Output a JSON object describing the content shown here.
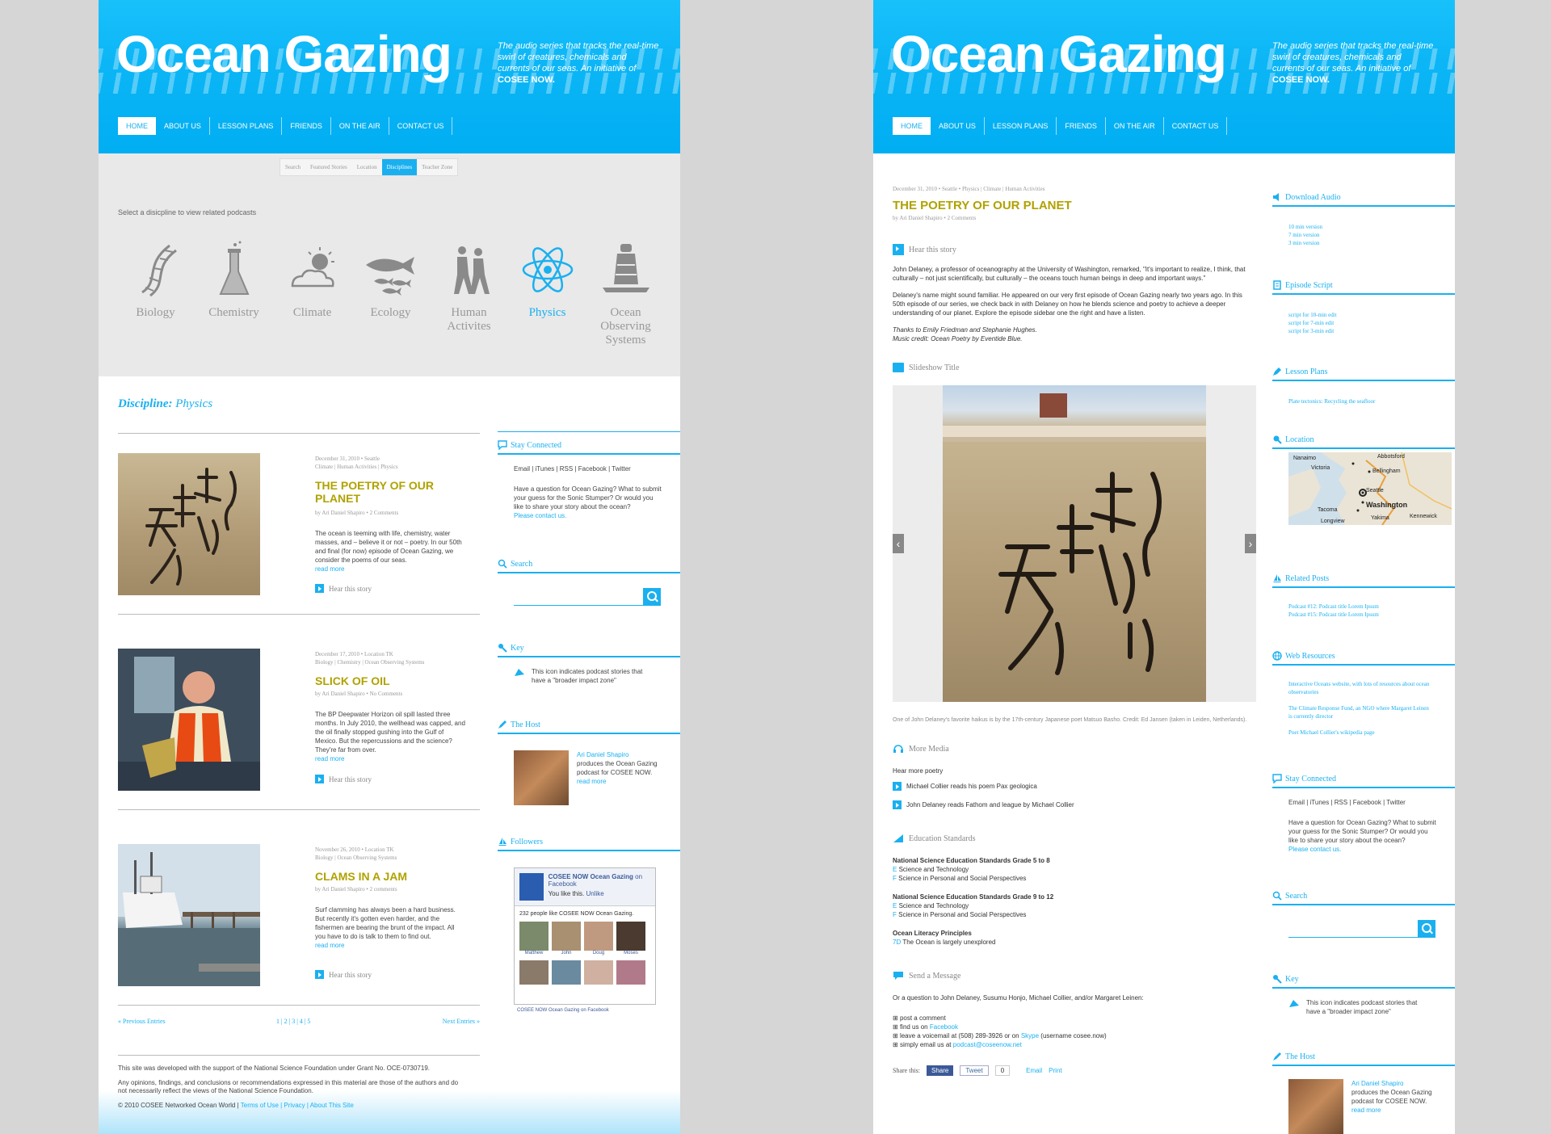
{
  "brand": {
    "title": "Ocean Gazing",
    "tagline": "The audio series that tracks the real-time swirl of creatures, chemicals and currents of our seas. An initiative of",
    "tagline_bold": "COSEE NOW."
  },
  "nav": [
    "HOME",
    "ABOUT US",
    "LESSON PLANS",
    "FRIENDS",
    "ON THE AIR",
    "CONTACT US"
  ],
  "subtabs": [
    "Search",
    "Featured Stories",
    "Location",
    "Disciplines",
    "Teacher Zone"
  ],
  "disciplines": {
    "prompt": "Select a disicpline to view related podcasts",
    "items": [
      "Biology",
      "Chemistry",
      "Climate",
      "Ecology",
      "Human Activites",
      "Physics",
      "Ocean Observing Systems"
    ],
    "heading_label": "Discipline:",
    "heading_value": "Physics"
  },
  "posts": [
    {
      "meta1": "December 31, 2010 • Seattle",
      "meta2": "Climate | Human Activities | Physics",
      "title": "THE POETRY OF OUR PLANET",
      "byline": "by Ari Daniel Shapiro • 2 Comments",
      "excerpt": "The ocean is teeming with life, chemistry, water masses, and – believe it or not – poetry. In our 50th and final (for now) episode of Ocean Gazing, we consider the poems of our seas.",
      "read_more": "read more",
      "hear": "Hear this story"
    },
    {
      "meta1": "December 17, 2010 • Location TK",
      "meta2": "Biology | Chemistry | Ocean Observing Systems",
      "title": "SLICK OF OIL",
      "byline": "by Ari Daniel Shapiro • No Comments",
      "excerpt": "The BP Deepwater Horizon oil spill lasted three months. In July 2010, the wellhead was capped, and the oil finally stopped gushing into the Gulf of Mexico. But the repercussions and the science? They're far from over.",
      "read_more": "read more",
      "hear": "Hear this story"
    },
    {
      "meta1": "November 26, 2010 • Location TK",
      "meta2": "Biology | Ocean Observing Systems",
      "title": "CLAMS IN A JAM",
      "byline": "by Ari Daniel Shapiro • 2 comments",
      "excerpt": "Surf clamming has always been a hard business. But recently it's gotten even harder, and the fishermen are bearing the brunt of the impact. All you have to do is talk to them to find out.",
      "read_more": "read more",
      "hear": "Hear this story"
    }
  ],
  "pager": {
    "prev": "« Previous Entries",
    "pages": "1 | 2 | 3 | 4 | 5",
    "next": "Next Entries »"
  },
  "footer": {
    "line1": "This site was developed with the support of the National Science Foundation under Grant No. OCE-0730719.",
    "line2": "Any opinions, findings, and conclusions or recommendations expressed in this material are those of the authors and do not necessarily reflect the views of the National Science Foundation.",
    "copyright": "© 2010 COSEE Networked Ocean World",
    "links": "Terms of Use | Privacy | About This Site"
  },
  "sidebar": {
    "stay_connected": "Stay Connected",
    "channels": "Email | iTunes | RSS | Facebook | Twitter",
    "question": "Have a question for Ocean Gazing? What to submit your guess for the Sonic Stumper? Or would you like to share your story about the ocean?",
    "contact": "Please contact us.",
    "search": "Search",
    "key": "Key",
    "key_text": "This icon indicates podcast stories that have a \"broader impact zone\"",
    "host": "The Host",
    "host_name": "Ari Daniel Shapiro",
    "host_text": "produces the Ocean Gazing podcast for COSEE NOW.",
    "host_more": "read more",
    "followers": "Followers",
    "fb_title": "COSEE NOW Ocean Gazing",
    "fb_on": "on Facebook",
    "fb_like": "You like this.",
    "fb_unlike": "Unlike",
    "fb_count": "232 people like COSEE NOW Ocean Gazing.",
    "fb_names": [
      "Matthew",
      "John",
      "Doug",
      "Moses"
    ],
    "fb_footer": "COSEE NOW Ocean Gazing on Facebook"
  },
  "article": {
    "meta": "December 31, 2010 • Seattle • Physics | Climate | Human Activities",
    "title": "THE POETRY OF OUR PLANET",
    "byline": "by Ari Daniel Shapiro • 2 Comments",
    "hear": "Hear this story",
    "p1": "John Delaney, a professor of oceanography at the University of Washington, remarked, \"It's important to realize, I think, that culturally – not just scientifically, but culturally – the oceans touch human beings in deep and important ways.\"",
    "p2": "Delaney's name might sound familiar. He appeared on our very first episode of Ocean Gazing nearly two years ago. In this 50th episode of our series, we check back in with Delaney on how he blends science and poetry to achieve a deeper understanding of our planet. Explore the episode sidebar one the right and have a listen.",
    "thanks": "Thanks to Emily Friedman and Stephanie Hughes.",
    "music": "Music credit: Ocean Poetry by Eventide Blue.",
    "slideshow": "Slideshow Title",
    "caption": "One of John Delaney's favorite haikus is by the 17th-century Japanese poet Matsuo Basho. Credit: Ed Jansen (taken in Leiden, Netherlands).",
    "more_media": "More Media",
    "hear_more": "Hear more poetry",
    "media": [
      "Michael Collier reads his poem Pax geologica",
      "John Delaney reads Fathom and league by Michael Collier"
    ],
    "edu": "Education Standards",
    "std1_title": "National Science Education Standards Grade 5 to 8",
    "std2_title": "National Science Education Standards Grade 9 to 12",
    "std_e": "E",
    "std_f": "F",
    "std_items": [
      "Science and Technology",
      "Science in Personal and Social Perspectives"
    ],
    "olp_title": "Ocean Literacy Principles",
    "olp_code": "7D",
    "olp_item": "The Ocean is largely unexplored",
    "send": "Send a Message",
    "send_intro": "Or a question to John Delaney, Susumu Honjo, Michael Collier, and/or Margaret Leinen:",
    "post_comment": "post a comment",
    "find_us": "find us on",
    "facebook": "Facebook",
    "voicemail": "leave a voicemail at (508) 289-3926 or on",
    "skype": "Skype",
    "skype_user": "(username cosee.now)",
    "email_us": "simply email us at",
    "email": "podcast@coseenow.net",
    "share": "Share this:",
    "share_fb": "Share",
    "tweet": "Tweet",
    "tweet_count": "0",
    "email_btn": "Email",
    "print_btn": "Print"
  },
  "right_sidebar": {
    "download": "Download Audio",
    "versions": [
      "10 min version",
      "7 min version",
      "3 min version"
    ],
    "script": "Episode Script",
    "scripts": [
      "script for 10-min edit",
      "script for 7-min edit",
      "script for 3-min edit"
    ],
    "lessons": "Lesson Plans",
    "lesson": "Plate tectonics: Recycling the seafloor",
    "location": "Location",
    "map_labels": [
      "Abbotsford",
      "Nanaimo",
      "Victoria",
      "Bellingham",
      "Seattle",
      "Tacoma",
      "Washington",
      "Yakima",
      "Kennewick",
      "Longview"
    ],
    "related": "Related Posts",
    "related_items": [
      "Podcast #12: Podcast title Lorem Ipsum",
      "Podcast #15: Podcast title Lorem Ipsum"
    ],
    "web": "Web Resources",
    "web_items": [
      "Interactive Oceans website, with lots of resources about ocean observatories",
      "The Climate Response Fund, an NGO where Margaret Leinen is currently director",
      "Poet Michael Collier's wikipedia page"
    ]
  },
  "colors": {
    "accent": "#1ab0f0",
    "title_olive": "#b0a200",
    "header_blue": "#00aef2"
  }
}
